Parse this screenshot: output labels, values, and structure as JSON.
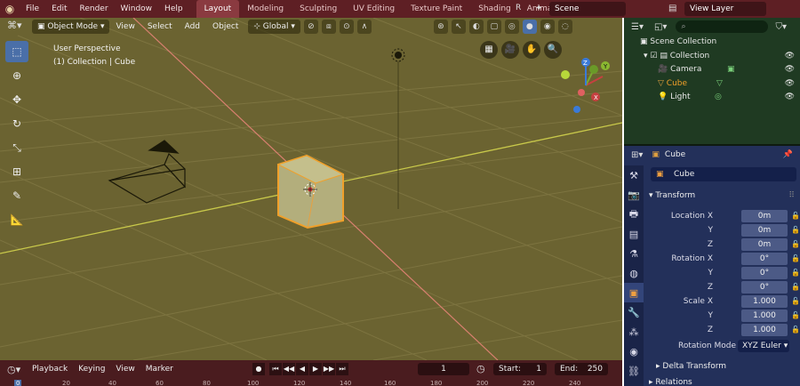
{
  "topbar": {
    "menus": [
      "File",
      "Edit",
      "Render",
      "Window",
      "Help"
    ],
    "workspaces": [
      "Layout",
      "Modeling",
      "Sculpting",
      "UV Editing",
      "Texture Paint",
      "Shading",
      "Animation"
    ],
    "active_workspace": "Layout",
    "r_label": "R",
    "scene": "Scene",
    "view_layer": "View Layer"
  },
  "viewport": {
    "mode": "Object Mode",
    "menus": [
      "View",
      "Select",
      "Add",
      "Object"
    ],
    "orientation": "Global",
    "info_line1": "User Perspective",
    "info_line2": "(1) Collection | Cube",
    "axis_labels": {
      "x": "X",
      "y": "Y",
      "z": "Z"
    },
    "colors": {
      "background": "#6b6331",
      "x_axis": "#d98070",
      "y_axis": "#c8c84a",
      "selection": "#f0a02a"
    }
  },
  "toolbar": {
    "tools": [
      "select-icon",
      "cursor-icon",
      "move-icon",
      "rotate-icon",
      "scale-icon",
      "transform-icon",
      "annotate-icon",
      "measure-icon"
    ]
  },
  "timeline": {
    "menus": [
      "Playback",
      "Keying",
      "View",
      "Marker"
    ],
    "current_frame": "1",
    "start_label": "Start:",
    "start_value": "1",
    "end_label": "End:",
    "end_value": "250",
    "ruler": [
      "0",
      "20",
      "40",
      "60",
      "80",
      "100",
      "120",
      "140",
      "160",
      "180",
      "200",
      "220",
      "240"
    ]
  },
  "outliner": {
    "root": "Scene Collection",
    "collection": "Collection",
    "items": [
      "Camera",
      "Cube",
      "Light"
    ],
    "active_item": "Cube"
  },
  "properties": {
    "object_name": "Cube",
    "name_field": "Cube",
    "transform_title": "Transform",
    "location": {
      "x_label": "Location X",
      "y_label": "Y",
      "z_label": "Z",
      "x": "0m",
      "y": "0m",
      "z": "0m"
    },
    "rotation": {
      "x_label": "Rotation X",
      "y_label": "Y",
      "z_label": "Z",
      "x": "0°",
      "y": "0°",
      "z": "0°"
    },
    "scale": {
      "x_label": "Scale X",
      "y_label": "Y",
      "z_label": "Z",
      "x": "1.000",
      "y": "1.000",
      "z": "1.000"
    },
    "rotation_mode_label": "Rotation Mode",
    "rotation_mode": "XYZ Euler",
    "delta_title": "Delta Transform",
    "relations_title": "Relations"
  }
}
